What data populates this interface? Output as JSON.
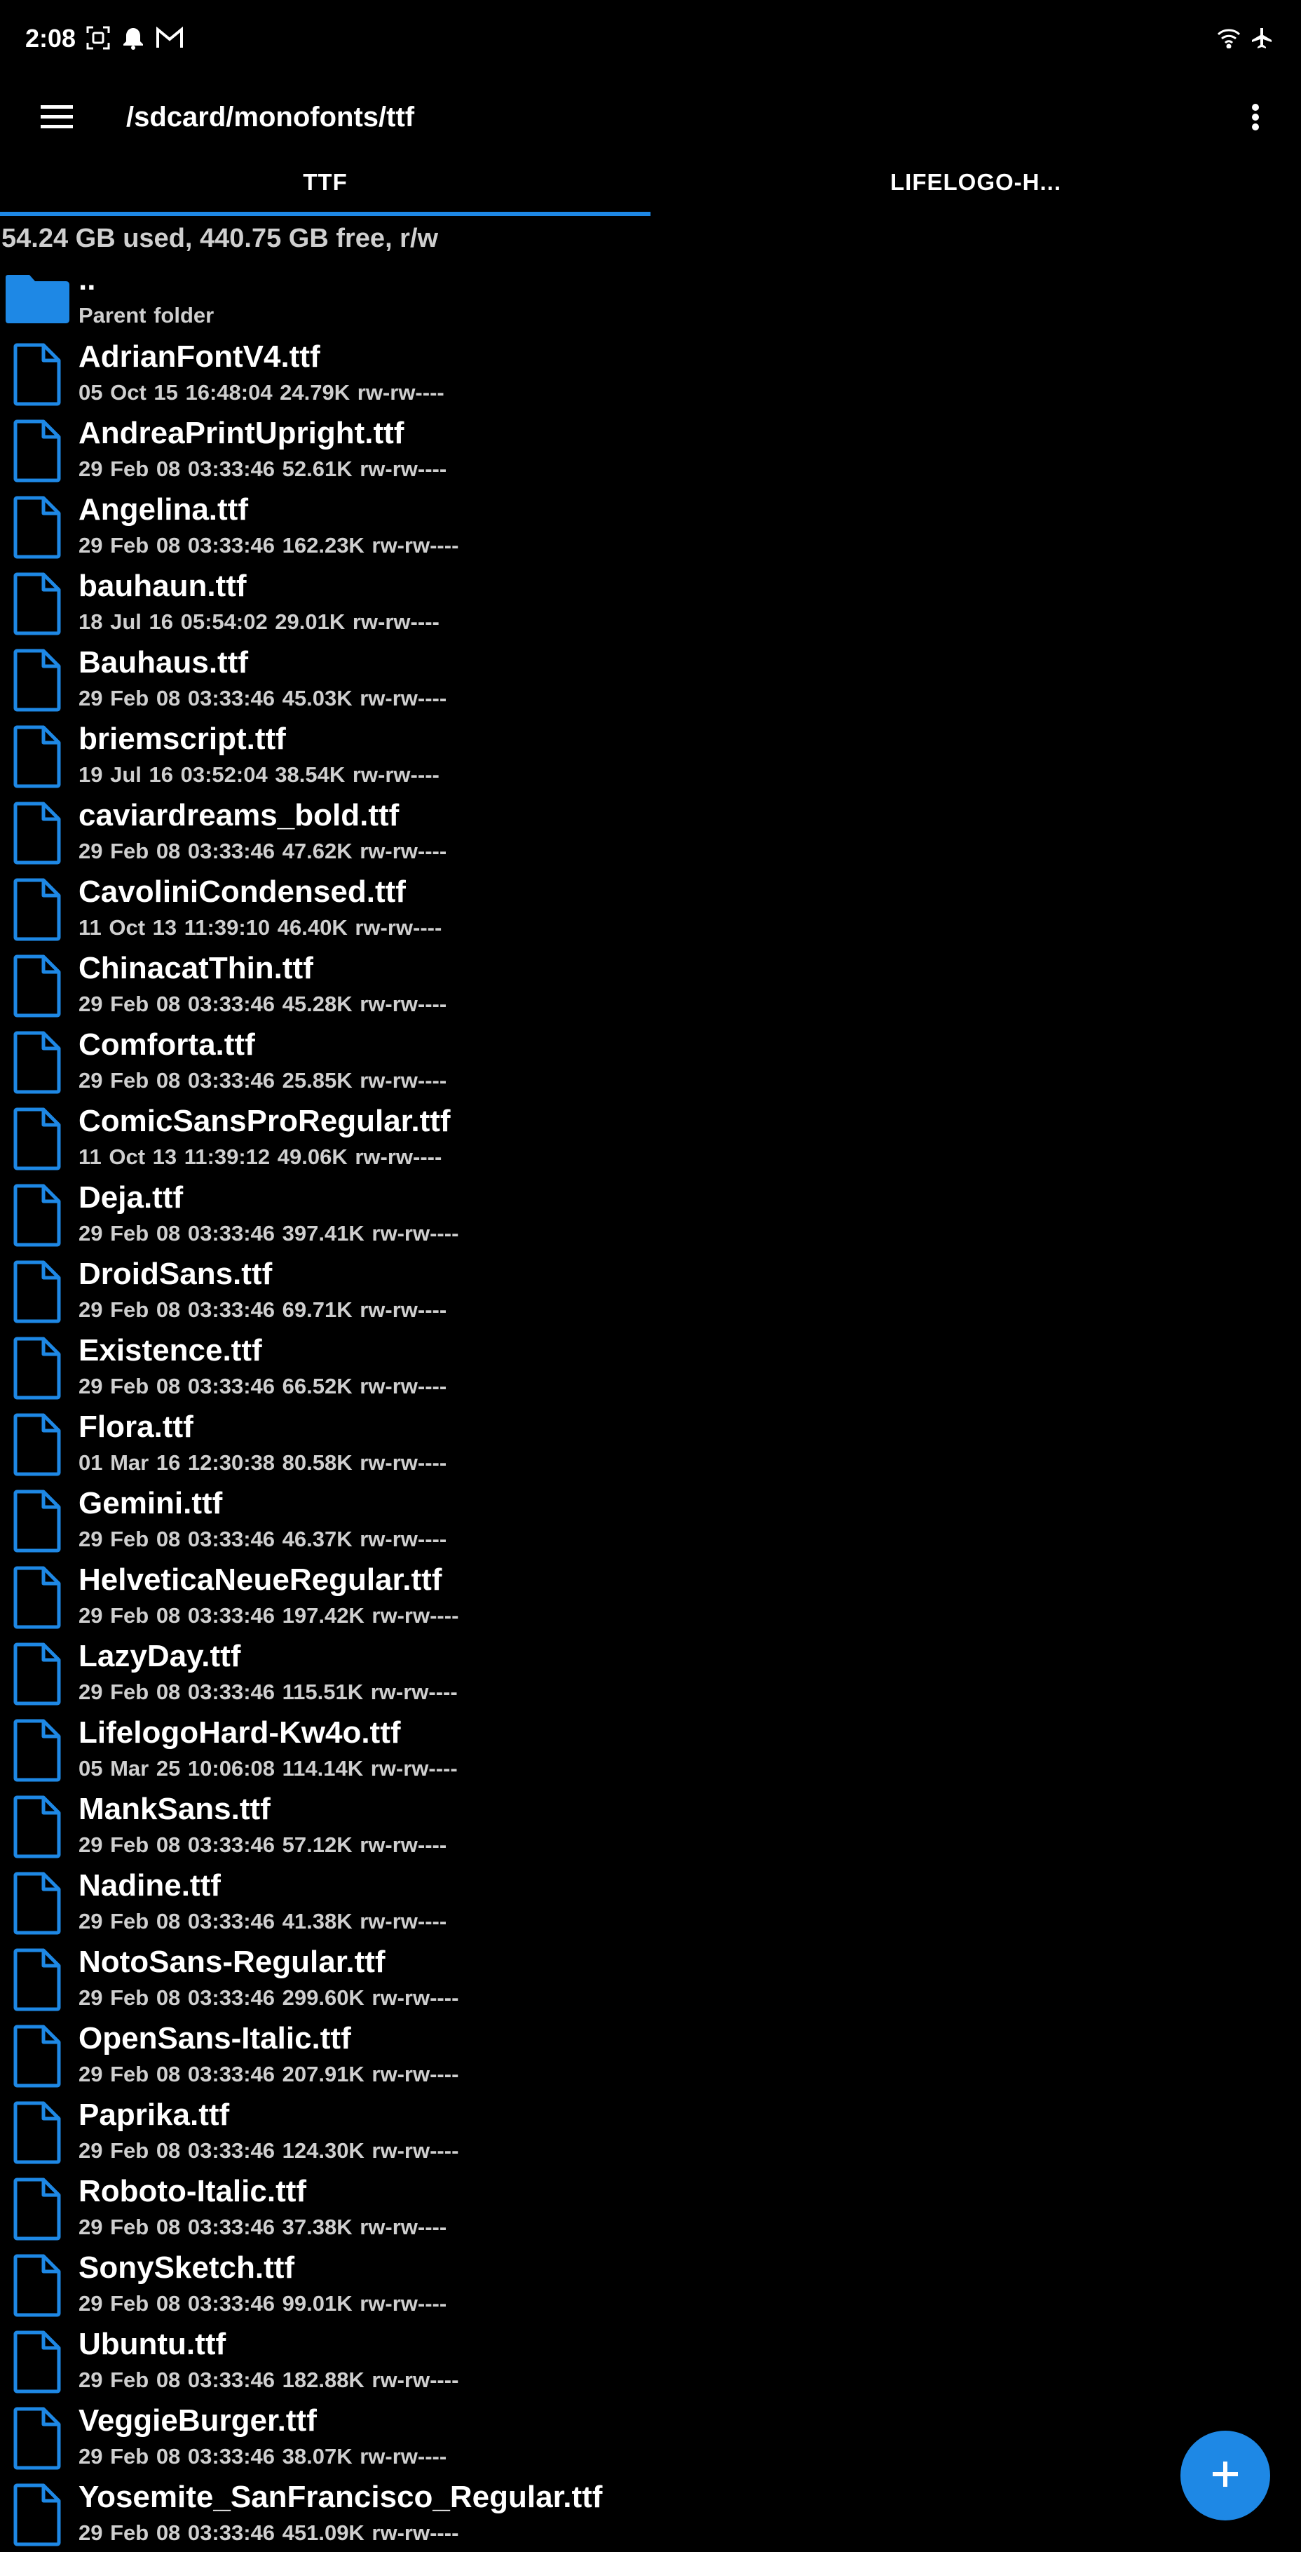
{
  "status_bar": {
    "time": "2:08",
    "left_icons": [
      "screenshot-icon",
      "alarm-icon",
      "gmail-icon"
    ],
    "right_icons": [
      "wifi-icon",
      "airplane-mode-icon"
    ]
  },
  "app_bar": {
    "menu_icon": "hamburger-menu-icon",
    "path": "/sdcard/monofonts/ttf",
    "overflow_icon": "more-vert-icon"
  },
  "tabs": [
    {
      "label": "TTF",
      "active": true
    },
    {
      "label": "LIFELOGO-H...",
      "active": false
    }
  ],
  "colors": {
    "accent": "#1e88e5",
    "background": "#000000",
    "text_primary": "#ffffff",
    "text_secondary": "#cfcfcf"
  },
  "storage_info": "54.24 GB used, 440.75 GB free, r/w",
  "parent_folder": {
    "name": "..",
    "label": "Parent folder",
    "icon": "folder-icon"
  },
  "files": [
    {
      "name": "AdrianFontV4.ttf",
      "meta": "05 Oct 15 16:48:04  24.79K  rw-rw----"
    },
    {
      "name": "AndreaPrintUpright.ttf",
      "meta": "29 Feb 08 03:33:46  52.61K  rw-rw----"
    },
    {
      "name": "Angelina.ttf",
      "meta": "29 Feb 08 03:33:46  162.23K  rw-rw----"
    },
    {
      "name": "bauhaun.ttf",
      "meta": "18 Jul 16 05:54:02  29.01K  rw-rw----"
    },
    {
      "name": "Bauhaus.ttf",
      "meta": "29 Feb 08 03:33:46  45.03K  rw-rw----"
    },
    {
      "name": "briemscript.ttf",
      "meta": "19 Jul 16 03:52:04  38.54K  rw-rw----"
    },
    {
      "name": "caviardreams_bold.ttf",
      "meta": "29 Feb 08 03:33:46  47.62K  rw-rw----"
    },
    {
      "name": "CavoliniCondensed.ttf",
      "meta": "11 Oct 13 11:39:10  46.40K  rw-rw----"
    },
    {
      "name": "ChinacatThin.ttf",
      "meta": "29 Feb 08 03:33:46  45.28K  rw-rw----"
    },
    {
      "name": "Comforta.ttf",
      "meta": "29 Feb 08 03:33:46  25.85K  rw-rw----"
    },
    {
      "name": "ComicSansProRegular.ttf",
      "meta": "11 Oct 13 11:39:12  49.06K  rw-rw----"
    },
    {
      "name": "Deja.ttf",
      "meta": "29 Feb 08 03:33:46  397.41K  rw-rw----"
    },
    {
      "name": "DroidSans.ttf",
      "meta": "29 Feb 08 03:33:46  69.71K  rw-rw----"
    },
    {
      "name": "Existence.ttf",
      "meta": "29 Feb 08 03:33:46  66.52K  rw-rw----"
    },
    {
      "name": "Flora.ttf",
      "meta": "01 Mar 16 12:30:38  80.58K  rw-rw----"
    },
    {
      "name": "Gemini.ttf",
      "meta": "29 Feb 08 03:33:46  46.37K  rw-rw----"
    },
    {
      "name": "HelveticaNeueRegular.ttf",
      "meta": "29 Feb 08 03:33:46  197.42K  rw-rw----"
    },
    {
      "name": "LazyDay.ttf",
      "meta": "29 Feb 08 03:33:46  115.51K  rw-rw----"
    },
    {
      "name": "LifelogoHard-Kw4o.ttf",
      "meta": "05 Mar 25 10:06:08  114.14K  rw-rw----"
    },
    {
      "name": "MankSans.ttf",
      "meta": "29 Feb 08 03:33:46  57.12K  rw-rw----"
    },
    {
      "name": "Nadine.ttf",
      "meta": "29 Feb 08 03:33:46  41.38K  rw-rw----"
    },
    {
      "name": "NotoSans-Regular.ttf",
      "meta": "29 Feb 08 03:33:46  299.60K  rw-rw----"
    },
    {
      "name": "OpenSans-Italic.ttf",
      "meta": "29 Feb 08 03:33:46  207.91K  rw-rw----"
    },
    {
      "name": "Paprika.ttf",
      "meta": "29 Feb 08 03:33:46  124.30K  rw-rw----"
    },
    {
      "name": "Roboto-Italic.ttf",
      "meta": "29 Feb 08 03:33:46  37.38K  rw-rw----"
    },
    {
      "name": "SonySketch.ttf",
      "meta": "29 Feb 08 03:33:46  99.01K  rw-rw----"
    },
    {
      "name": "Ubuntu.ttf",
      "meta": "29 Feb 08 03:33:46  182.88K  rw-rw----"
    },
    {
      "name": "VeggieBurger.ttf",
      "meta": "29 Feb 08 03:33:46  38.07K  rw-rw----"
    },
    {
      "name": "Yosemite_SanFrancisco_Regular.ttf",
      "meta": "29 Feb 08 03:33:46  451.09K  rw-rw----"
    }
  ],
  "fab": {
    "icon": "add-icon"
  }
}
